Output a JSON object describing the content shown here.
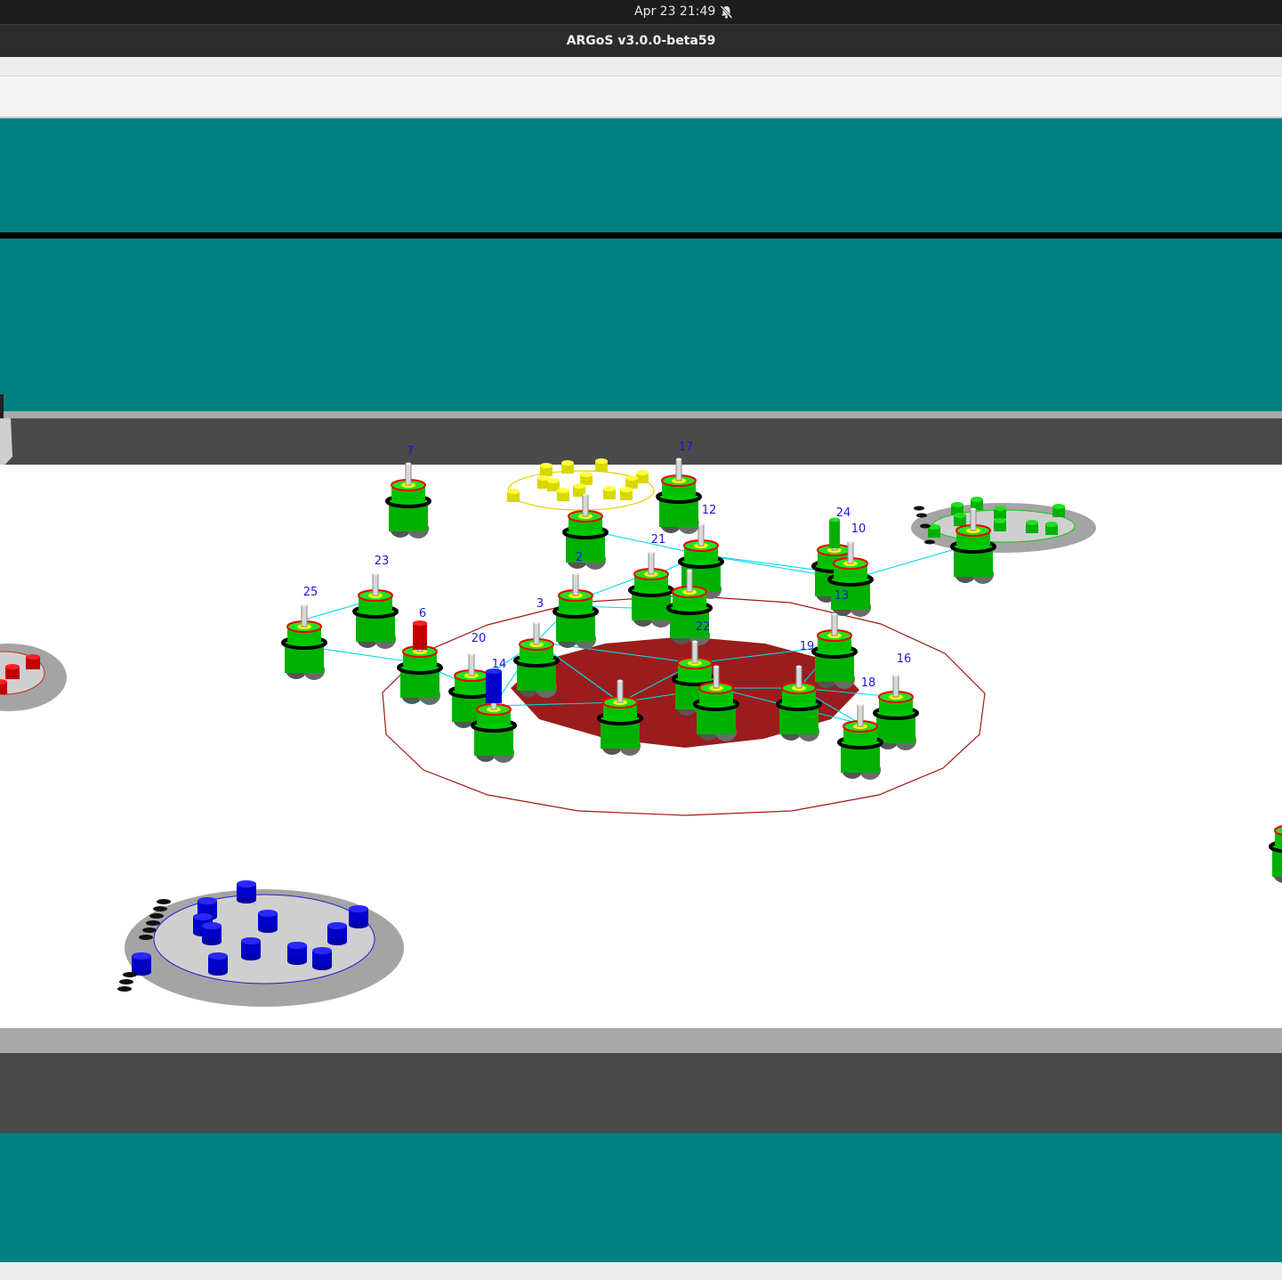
{
  "system_bar": {
    "clock": "Apr 23  21:49",
    "notifications_icon": "bell-muted-icon"
  },
  "window": {
    "title": "ARGoS v3.0.0-beta59"
  },
  "scene": {
    "background_color": "#008080",
    "floor_color": "#ffffff",
    "wall_color": "#4a4a4a",
    "nest_color": "#9b1c1c",
    "robot_color": "#00c000",
    "link_color": "#00d8e8",
    "robots": [
      {
        "id": "7"
      },
      {
        "id": "17"
      },
      {
        "id": "12"
      },
      {
        "id": "21"
      },
      {
        "id": "24"
      },
      {
        "id": "10"
      },
      {
        "id": "2"
      },
      {
        "id": "23"
      },
      {
        "id": "25"
      },
      {
        "id": "6"
      },
      {
        "id": "3"
      },
      {
        "id": "13"
      },
      {
        "id": "22"
      },
      {
        "id": "20"
      },
      {
        "id": "14"
      },
      {
        "id": "19"
      },
      {
        "id": "16"
      },
      {
        "id": "18"
      }
    ]
  }
}
